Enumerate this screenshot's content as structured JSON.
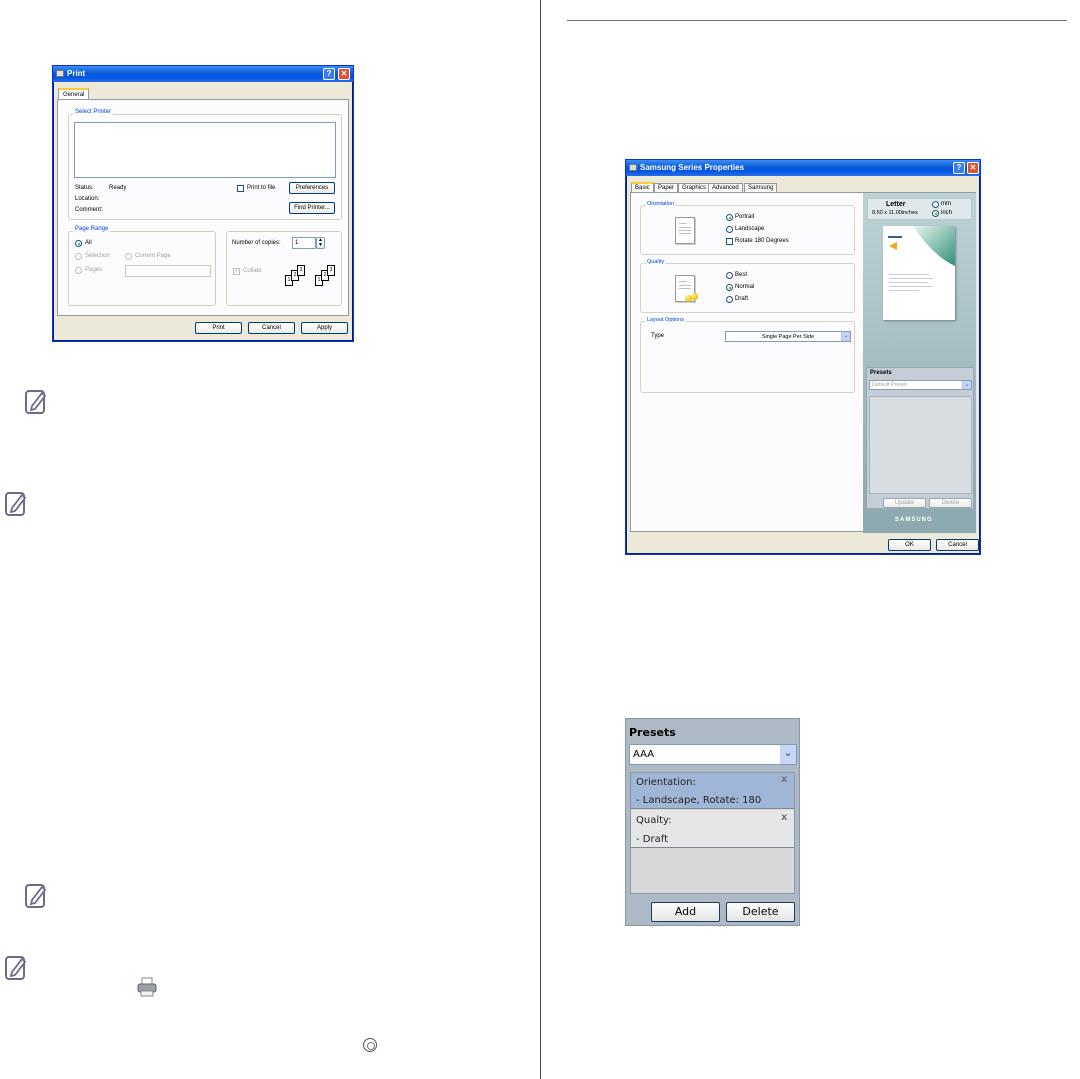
{
  "print_dialog": {
    "title": "Print",
    "tab_general": "General",
    "select_printer_label": "Select Printer",
    "status_label": "Status:",
    "status_value": "Ready",
    "location_label": "Location:",
    "comment_label": "Comment:",
    "print_to_file_label": "Print to file",
    "preferences_button": "Preferences",
    "find_printer_button": "Find Printer...",
    "page_range_label": "Page Range",
    "range_all": "All",
    "range_selection": "Selection",
    "range_current_page": "Current Page",
    "range_pages": "Pages:",
    "number_of_copies_label": "Number of copies:",
    "copies_value": "1",
    "collate_label": "Collate",
    "print_button": "Print",
    "cancel_button": "Cancel",
    "apply_button": "Apply",
    "help_glyph": "?",
    "close_glyph": "✕"
  },
  "properties_dialog": {
    "title": "Samsung Series Properties",
    "tabs": [
      "Basic",
      "Paper",
      "Graphics",
      "Advanced",
      "Samsung"
    ],
    "orientation_label": "Orientation",
    "portrait": "Portrait",
    "landscape": "Landscape",
    "rotate_180": "Rotate 180 Degrees",
    "quality_label": "Quality",
    "best": "Best",
    "normal": "Normal",
    "draft": "Draft",
    "layout_options_label": "Layout Options",
    "type_label": "Type",
    "type_value": "Single Page Per Side",
    "paper_name": "Letter",
    "paper_size": "8.50 x 11.00inches",
    "unit_mm": "mm",
    "unit_inch": "inch",
    "presets_label": "Presets",
    "default_preset": "Default Preset",
    "update_button": "Update",
    "delete_button": "Delete",
    "brand": "SAMSUNG",
    "ok_button": "OK",
    "cancel_button": "Cancel",
    "help_glyph": "?",
    "close_glyph": "✕"
  },
  "presets_panel": {
    "title": "Presets",
    "input_value": "AAA",
    "items": [
      {
        "heading": "Orientation:",
        "detail": "- Landscape, Rotate: 180"
      },
      {
        "heading": "Qualty:",
        "detail": "- Draft"
      }
    ],
    "remove_glyph": "x",
    "add_button": "Add",
    "delete_button": "Delete"
  },
  "icons": [
    "note-icon",
    "printer-icon",
    "circle-icon"
  ],
  "colors": {
    "xp_title_blue": "#0054e3",
    "xp_face": "#ece9d8",
    "selected_row": "#9fb6d6",
    "presets_frame": "#adb9c4"
  }
}
